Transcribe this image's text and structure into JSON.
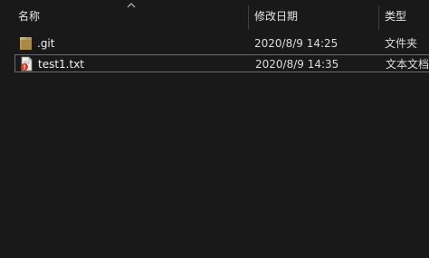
{
  "header": {
    "name_label": "名称",
    "date_label": "修改日期",
    "type_label": "类型",
    "sort": "ascending"
  },
  "files": [
    {
      "name": ".git",
      "modified": "2020/8/9 14:25",
      "type": "文件夹",
      "icon": "folder-icon",
      "selected": false
    },
    {
      "name": "test1.txt",
      "modified": "2020/8/9 14:35",
      "type": "文本文档",
      "icon": "text-file-icon",
      "selected": true
    }
  ],
  "colors": {
    "background": "#191919",
    "folder": "#b89a55",
    "badge": "#d23c2b",
    "selection_border": "#6b6b6b"
  }
}
